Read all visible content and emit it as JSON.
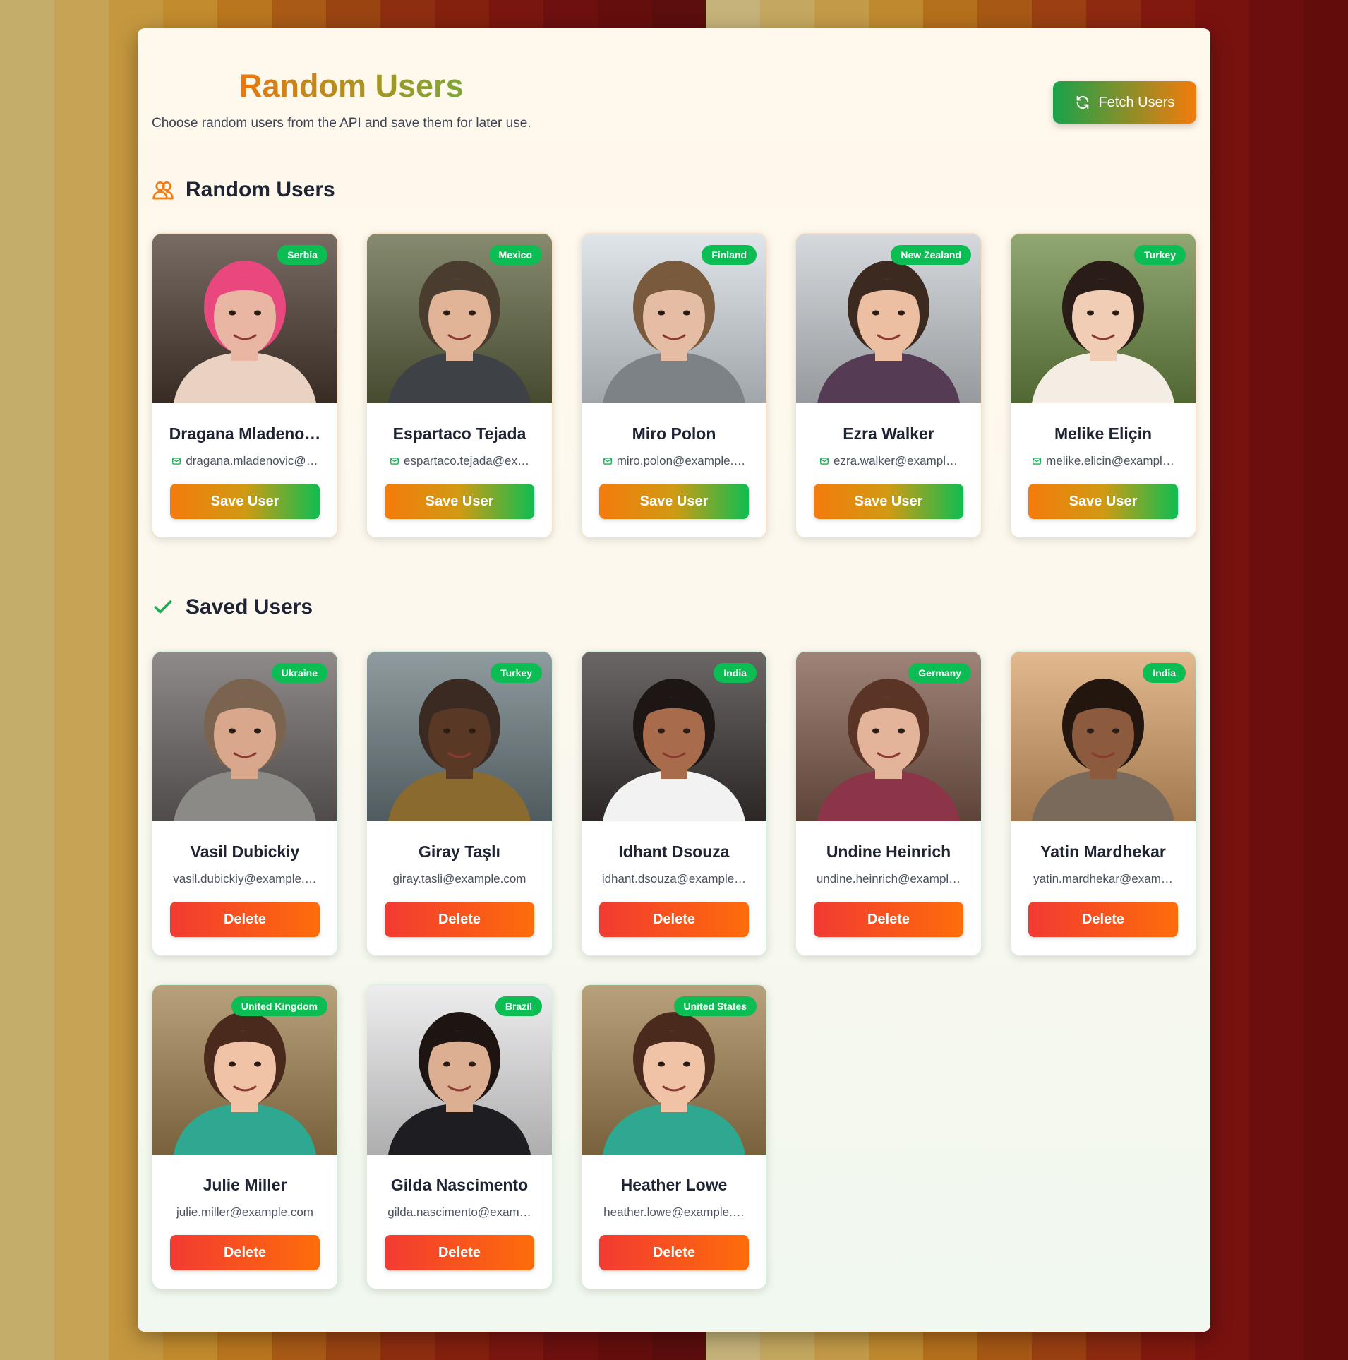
{
  "header": {
    "title": "Random Users",
    "subtitle": "Choose random users from the API and save them for later use.",
    "fetch_label": "Fetch Users"
  },
  "random_section": {
    "title": "Random Users",
    "icon": "users-icon"
  },
  "saved_section": {
    "title": "Saved Users",
    "icon": "check-icon"
  },
  "random_users": [
    {
      "name": "Dragana Mladeno…",
      "email": "dragana.mladenovic@…",
      "country": "Serbia",
      "action": "Save User"
    },
    {
      "name": "Espartaco Tejada",
      "email": "espartaco.tejada@ex…",
      "country": "Mexico",
      "action": "Save User"
    },
    {
      "name": "Miro Polon",
      "email": "miro.polon@example.…",
      "country": "Finland",
      "action": "Save User"
    },
    {
      "name": "Ezra Walker",
      "email": "ezra.walker@exampl…",
      "country": "New Zealand",
      "action": "Save User"
    },
    {
      "name": "Melike Eliçin",
      "email": "melike.elicin@exampl…",
      "country": "Turkey",
      "action": "Save User"
    }
  ],
  "saved_users": [
    {
      "name": "Vasil Dubickiy",
      "email": "vasil.dubickiy@example.…",
      "country": "Ukraine",
      "action": "Delete"
    },
    {
      "name": "Giray Taşlı",
      "email": "giray.tasli@example.com",
      "country": "Turkey",
      "action": "Delete"
    },
    {
      "name": "Idhant Dsouza",
      "email": "idhant.dsouza@example…",
      "country": "India",
      "action": "Delete"
    },
    {
      "name": "Undine Heinrich",
      "email": "undine.heinrich@exampl…",
      "country": "Germany",
      "action": "Delete"
    },
    {
      "name": "Yatin Mardhekar",
      "email": "yatin.mardhekar@exam…",
      "country": "India",
      "action": "Delete"
    },
    {
      "name": "Julie Miller",
      "email": "julie.miller@example.com",
      "country": "United Kingdom",
      "action": "Delete"
    },
    {
      "name": "Gilda Nascimento",
      "email": "gilda.nascimento@exam…",
      "country": "Brazil",
      "action": "Delete"
    },
    {
      "name": "Heather Lowe",
      "email": "heather.lowe@example.…",
      "country": "United States",
      "action": "Delete"
    }
  ],
  "colors": {
    "badge": "#0cbd53",
    "save_gradient_start": "#f47b0c",
    "save_gradient_end": "#0fbd52",
    "delete_gradient_start": "#f23a32",
    "delete_gradient_end": "#fe6d0a",
    "title_gradient_start": "#e8780e",
    "title_gradient_end": "#7aa834"
  }
}
